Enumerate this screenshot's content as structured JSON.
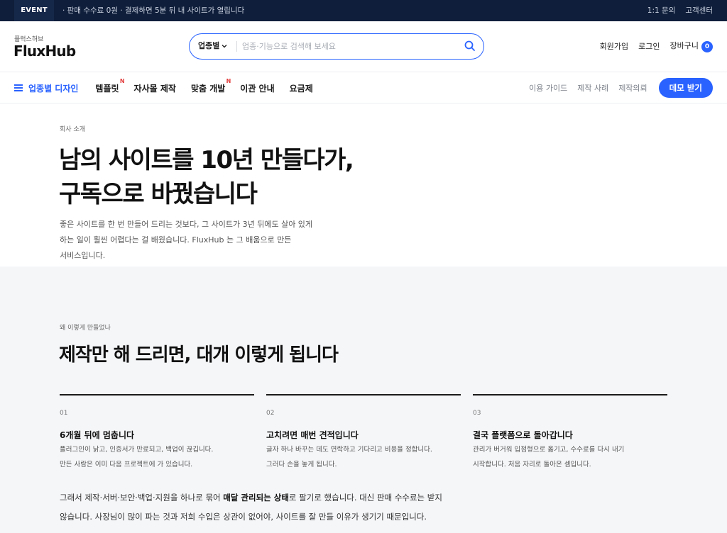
{
  "event": {
    "badge": "EVENT",
    "text": "· 판매 수수료 0원 · 결제하면 5분 뒤 내 사이트가 열립니다",
    "links": [
      "1:1 문의",
      "고객센터"
    ]
  },
  "header": {
    "logo_sub": "플럭스허브",
    "logo": "FluxHub",
    "search": {
      "category": "업종별",
      "placeholder": "업종·기능으로 검색해 보세요",
      "value": ""
    },
    "auth": {
      "signup": "회원가입",
      "login": "로그인",
      "cart": "장바구니",
      "cart_count": "0"
    }
  },
  "nav": {
    "category_label": "업종별 디자인",
    "items": [
      {
        "label": "템플릿",
        "badge": "N"
      },
      {
        "label": "자사몰 제작",
        "badge": ""
      },
      {
        "label": "맞춤 개발",
        "badge": "N"
      },
      {
        "label": "이관 안내",
        "badge": ""
      },
      {
        "label": "요금제",
        "badge": ""
      }
    ],
    "right_links": [
      "이용 가이드",
      "제작 사례",
      "제작의뢰"
    ],
    "demo_button": "데모 받기"
  },
  "hero": {
    "eyebrow": "회사 소개",
    "title_line1": "남의 사이트를 10년 만들다가,",
    "title_line2": "구독으로 바꿨습니다",
    "desc_line1": "좋은 사이트를 한 번 만들어 드리는 것보다, 그 사이트가 3년 뒤에도 살아 있게",
    "desc_line2": "하는 일이 훨씬 어렵다는 걸 배웠습니다. FluxHub 는 그 배움으로 만든",
    "desc_line3": "서비스입니다."
  },
  "why": {
    "eyebrow": "왜 이렇게 만들었나",
    "title": "제작만 해 드리면, 대개 이렇게 됩니다",
    "columns": [
      {
        "num": "01",
        "title": "6개월 뒤에 멈춥니다",
        "desc1": "플러그인이 낡고, 인증서가 만료되고, 백업이 끊깁니다.",
        "desc2": "만든 사람은 이미 다음 프로젝트에 가 있습니다."
      },
      {
        "num": "02",
        "title": "고치려면 매번 견적입니다",
        "desc1": "글자 하나 바꾸는 데도 연락하고 기다리고 비용을 정합니다.",
        "desc2": "그러다 손을 놓게 됩니다."
      },
      {
        "num": "03",
        "title": "결국 플랫폼으로 돌아갑니다",
        "desc1": "관리가 버거워 입점형으로 옮기고, 수수료를 다시 내기",
        "desc2": "시작합니다. 처음 자리로 돌아온 셈입니다."
      }
    ],
    "foot_pre": "그래서 제작·서버·보안·백업·지원을 하나로 묶어 ",
    "foot_bold": "매달 관리되는 상태",
    "foot_post1": "로 팔기로 했습니다. 대신 판매 수수료는 받지",
    "foot_line2": "않습니다. 사장님이 많이 파는 것과 저희 수입은 상관이 없어야, 사이트를 잘 만들 이유가 생기기 때문입니다."
  }
}
